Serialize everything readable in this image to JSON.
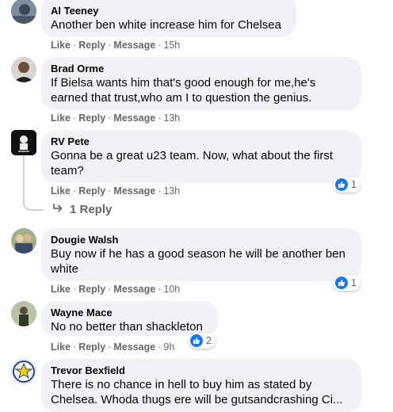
{
  "actions": {
    "like": "Like",
    "reply": "Reply",
    "message": "Message"
  },
  "colors": {
    "bubble": "#f0f2f5",
    "meta": "#65676b",
    "like_blue": "#1877f2"
  },
  "comments": [
    {
      "author": "Al Teeney",
      "text": "Another ben white increase him for Chelsea",
      "time": "15h"
    },
    {
      "author": "Brad Orme",
      "text": "If Bielsa wants him that's good enough for me,he's earned that trust,who am I to question the genius.",
      "time": "13h"
    },
    {
      "author": "RV Pete",
      "text": "Gonna be a great u23 team. Now, what about the first team?",
      "time": "13h",
      "reactions": "1",
      "replies_label": "1 Reply"
    },
    {
      "author": "Dougie Walsh",
      "text": "Buy now if he has a good season he will be another ben white",
      "time": "10h",
      "reactions": "1"
    },
    {
      "author": "Wayne Mace",
      "text": "No no better than shackleton",
      "time": "9h",
      "reactions": "2"
    },
    {
      "author": "Trevor Bexfield",
      "text": "There is no chance in hell to buy him as stated by Chelsea. Whoda thugs ere will be gutsandcrashing Ci..."
    }
  ],
  "reaction_icon": "thumbs-up-icon",
  "reply_arrow_icon": "reply-arrow-icon"
}
